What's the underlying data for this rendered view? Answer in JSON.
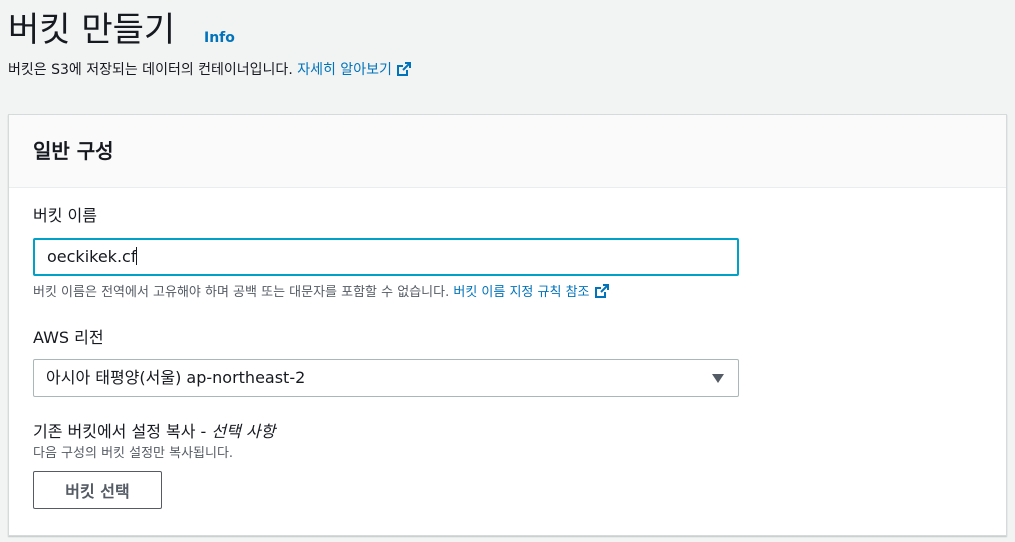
{
  "header": {
    "title": "버킷 만들기",
    "info_label": "Info",
    "description": "버킷은 S3에 저장되는 데이터의 컨테이너입니다. ",
    "learn_more": "자세히 알아보기"
  },
  "panel": {
    "title": "일반 구성",
    "bucket_name": {
      "label": "버킷 이름",
      "value": "oeckikek.cf",
      "hint": "버킷 이름은 전역에서 고유해야 하며 공백 또는 대문자를 포함할 수 없습니다. ",
      "rules_link": "버킷 이름 지정 규칙 참조"
    },
    "region": {
      "label": "AWS 리전",
      "selected": "아시아 태평양(서울) ap-northeast-2"
    },
    "copy_settings": {
      "label": "기존 버킷에서 설정 복사 - ",
      "optional": "선택 사항",
      "hint": "다음 구성의 버킷 설정만 복사됩니다.",
      "button": "버킷 선택"
    }
  },
  "colors": {
    "link": "#0073bb",
    "focus_border": "#00a1c9",
    "background": "#f2f3f3"
  },
  "icons": [
    "external-link-icon",
    "dropdown-caret-icon"
  ]
}
